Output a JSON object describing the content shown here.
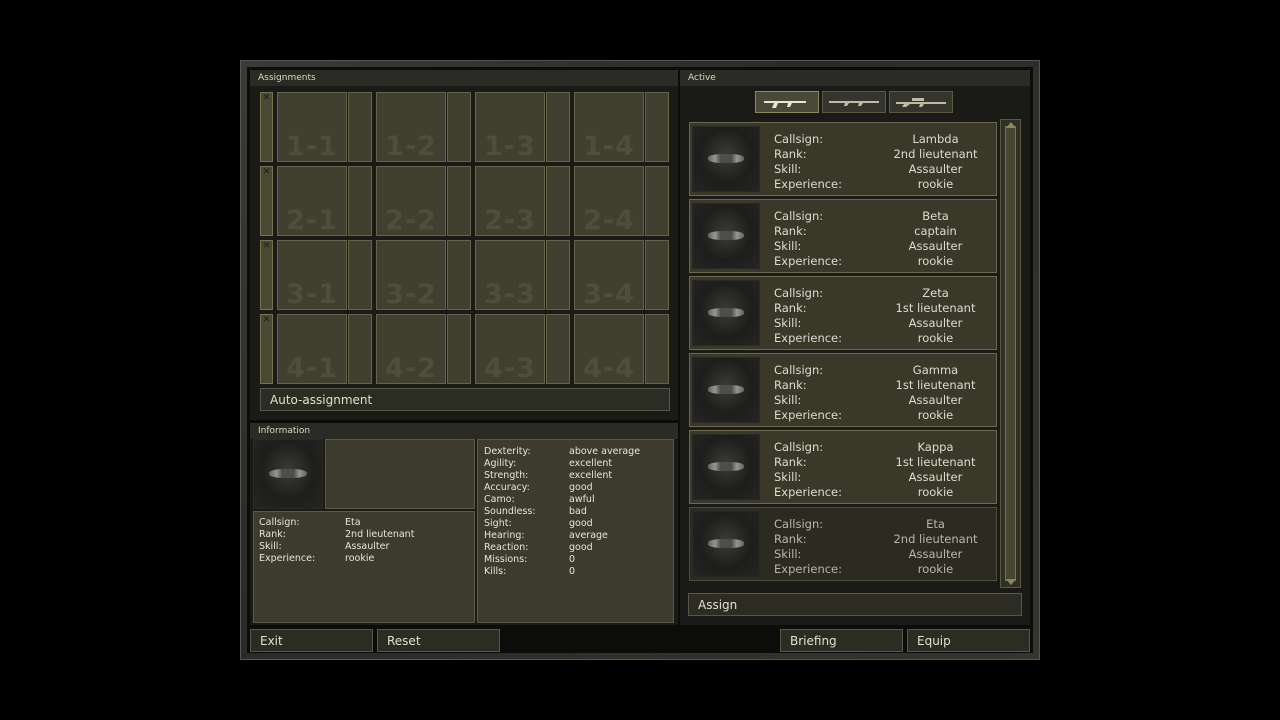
{
  "assignments": {
    "title": "Assignments",
    "slots": [
      [
        "1-1",
        "1-2",
        "1-3",
        "1-4"
      ],
      [
        "2-1",
        "2-2",
        "2-3",
        "2-4"
      ],
      [
        "3-1",
        "3-2",
        "3-3",
        "3-4"
      ],
      [
        "4-1",
        "4-2",
        "4-3",
        "4-4"
      ]
    ],
    "remove_glyph": "✕",
    "auto_button": "Auto-assignment"
  },
  "information": {
    "title": "Information",
    "labels": [
      "Callsign:",
      "Rank:",
      "Skill:",
      "Experience:"
    ],
    "values": [
      "Eta",
      "2nd lieutenant",
      "Assaulter",
      "rookie"
    ],
    "stats": [
      {
        "label": "Dexterity:",
        "value": "above average"
      },
      {
        "label": "Agility:",
        "value": "excellent"
      },
      {
        "label": "Strength:",
        "value": "excellent"
      },
      {
        "label": "Accuracy:",
        "value": "good"
      },
      {
        "label": "Camo:",
        "value": "awful"
      },
      {
        "label": "Soundless:",
        "value": "bad"
      },
      {
        "label": "Sight:",
        "value": "good"
      },
      {
        "label": "Hearing:",
        "value": "average"
      },
      {
        "label": "Reaction:",
        "value": "good"
      },
      {
        "label": "Missions:",
        "value": "0"
      },
      {
        "label": "Kills:",
        "value": "0"
      }
    ]
  },
  "active": {
    "title": "Active",
    "weapon_tabs": [
      "assault-rifle-icon",
      "grenade-launcher-icon",
      "sniper-rifle-icon"
    ],
    "labels": [
      "Callsign:",
      "Rank:",
      "Skill:",
      "Experience:"
    ],
    "soldiers": [
      {
        "callsign": "Lambda",
        "rank": "2nd lieutenant",
        "skill": "Assaulter",
        "experience": "rookie"
      },
      {
        "callsign": "Beta",
        "rank": "captain",
        "skill": "Assaulter",
        "experience": "rookie"
      },
      {
        "callsign": "Zeta",
        "rank": "1st lieutenant",
        "skill": "Assaulter",
        "experience": "rookie"
      },
      {
        "callsign": "Gamma",
        "rank": "1st lieutenant",
        "skill": "Assaulter",
        "experience": "rookie"
      },
      {
        "callsign": "Kappa",
        "rank": "1st lieutenant",
        "skill": "Assaulter",
        "experience": "rookie"
      },
      {
        "callsign": "Eta",
        "rank": "2nd lieutenant",
        "skill": "Assaulter",
        "experience": "rookie"
      }
    ],
    "assign_button": "Assign"
  },
  "footer": {
    "exit": "Exit",
    "reset": "Reset",
    "briefing": "Briefing",
    "equip": "Equip"
  }
}
